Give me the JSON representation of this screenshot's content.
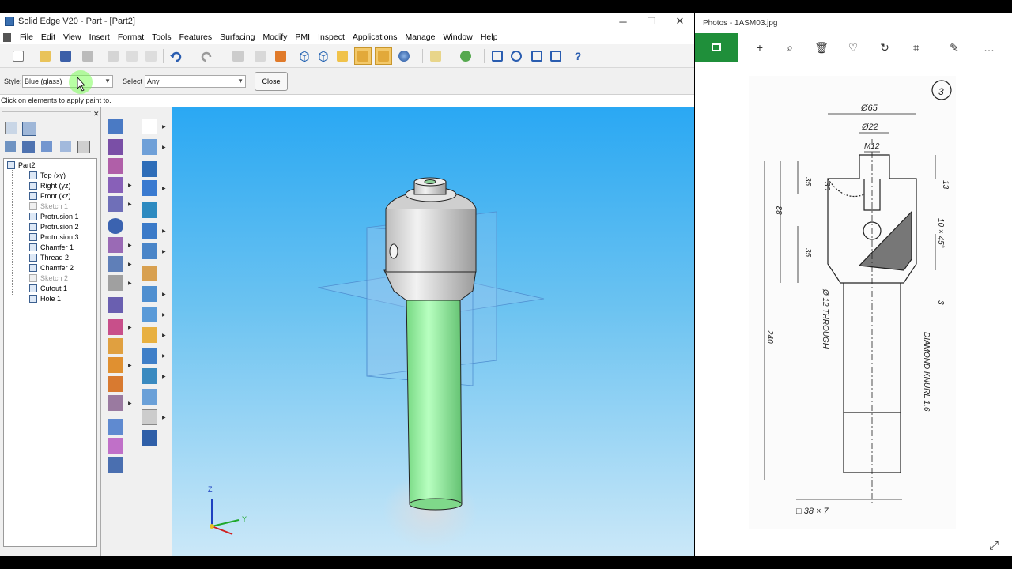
{
  "solid_edge": {
    "title": "Solid Edge V20 - Part - [Part2]",
    "window_controls": {
      "minimize": "─",
      "maximize": "☐",
      "close": "✕"
    },
    "menu": [
      "File",
      "Edit",
      "View",
      "Insert",
      "Format",
      "Tools",
      "Features",
      "Surfacing",
      "Modify",
      "PMI",
      "Inspect",
      "Applications",
      "Manage",
      "Window",
      "Help"
    ],
    "mdi_controls": {
      "minimize": "-",
      "restore": "▫",
      "close": "x"
    },
    "ribbon": {
      "style_label": "Style:",
      "style_value": "Blue (glass)",
      "select_label": "Select",
      "select_value": "Any",
      "close_label": "Close"
    },
    "prompt": "Click on elements to apply paint to.",
    "tree": {
      "root": "Part2",
      "items": [
        {
          "label": "Top (xy)",
          "dim": false
        },
        {
          "label": "Right (yz)",
          "dim": false
        },
        {
          "label": "Front (xz)",
          "dim": false
        },
        {
          "label": "Sketch 1",
          "dim": true
        },
        {
          "label": "Protrusion 1",
          "dim": false
        },
        {
          "label": "Protrusion 2",
          "dim": false
        },
        {
          "label": "Protrusion 3",
          "dim": false
        },
        {
          "label": "Chamfer 1",
          "dim": false
        },
        {
          "label": "Thread 2",
          "dim": false
        },
        {
          "label": "Chamfer 2",
          "dim": false
        },
        {
          "label": "Sketch 2",
          "dim": true
        },
        {
          "label": "Cutout 1",
          "dim": false
        },
        {
          "label": "Hole 1",
          "dim": false
        }
      ]
    },
    "axes": {
      "z": "Z",
      "y": "Y"
    },
    "colors": {
      "viewport_top": "#2aa8f3",
      "shaft": "#9ff0a8",
      "head": "#d9d9d9",
      "active_tool": "#f3c96b"
    }
  },
  "photos": {
    "title": "Photos - 1ASM03.jpg",
    "toolbar_icons": [
      "image-icon",
      "add-icon",
      "zoom-in-icon",
      "delete-icon",
      "favorite-icon",
      "rotate-icon",
      "crop-icon",
      "edit-icon",
      "more-icon"
    ],
    "accent": "#1f8f3a",
    "drawing": {
      "number": "3",
      "dims": [
        "Ø65",
        "Ø22",
        "M12",
        "13",
        "30",
        "35",
        "83",
        "35",
        "10 × 45°",
        "3",
        "240",
        "Ø 12 THROUGH",
        "DIAMOND KNURL 1.6",
        "□ 38 × 7"
      ]
    }
  }
}
